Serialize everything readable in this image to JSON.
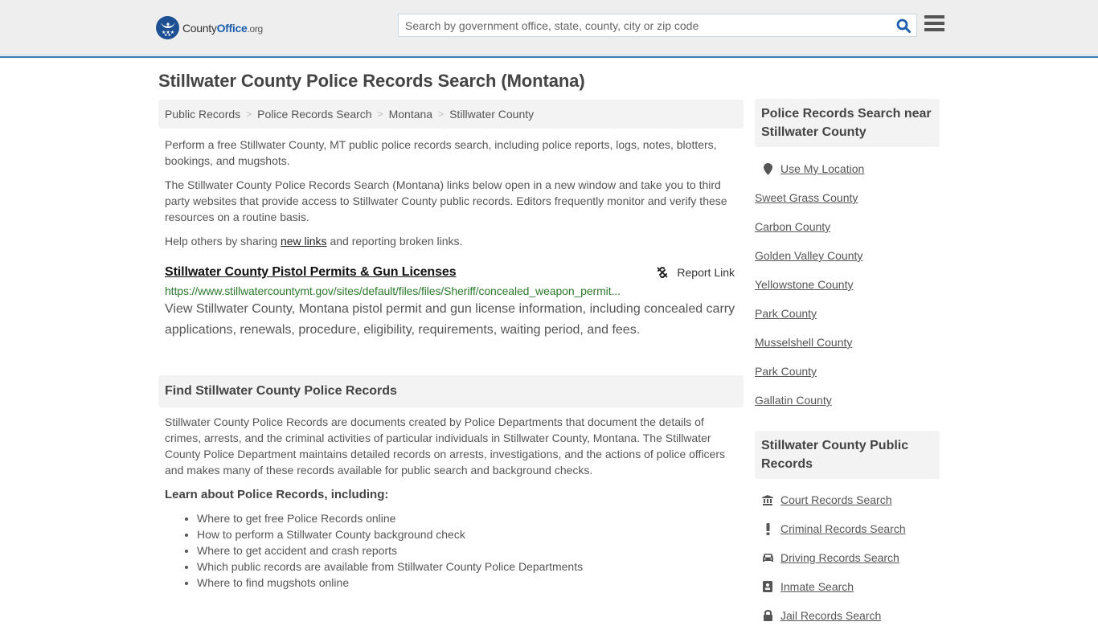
{
  "header": {
    "logo": {
      "part1": "County",
      "part2": "Office",
      "part3": ".org"
    },
    "search_placeholder": "Search by government office, state, county, city or zip code",
    "search_icon": "search-icon",
    "menu_icon": "hamburger-menu-icon"
  },
  "page_title": "Stillwater County Police Records Search (Montana)",
  "breadcrumb": [
    "Public Records",
    "Police Records Search",
    "Montana",
    "Stillwater County"
  ],
  "intro": {
    "p1": "Perform a free Stillwater County, MT public police records search, including police reports, logs, notes, blotters, bookings, and mugshots.",
    "p2": "The Stillwater County Police Records Search (Montana) links below open in a new window and take you to third party websites that provide access to Stillwater County public records. Editors frequently monitor and verify these resources on a routine basis.",
    "p3_before": "Help others by sharing ",
    "p3_link": "new links",
    "p3_after": " and reporting broken links."
  },
  "results": [
    {
      "title": "Stillwater County Pistol Permits & Gun Licenses",
      "url": "https://www.stillwatercountymt.gov/sites/default/files/files/Sheriff/concealed_weapon_permit...",
      "description": "View Stillwater County, Montana pistol permit and gun license information, including concealed carry applications, renewals, procedure, eligibility, requirements, waiting period, and fees.",
      "report_label": "Report Link"
    }
  ],
  "find_section": {
    "heading": "Find Stillwater County Police Records",
    "body": "Stillwater County Police Records are documents created by Police Departments that document the details of crimes, arrests, and the criminal activities of particular individuals in Stillwater County, Montana. The Stillwater County Police Department maintains detailed records on arrests, investigations, and the actions of police officers and makes many of these records available for public search and background checks.",
    "learn_heading": "Learn about Police Records, including:",
    "learn_items": [
      "Where to get free Police Records online",
      "How to perform a Stillwater County background check",
      "Where to get accident and crash reports",
      "Which public records are available from Stillwater County Police Departments",
      "Where to find mugshots online"
    ]
  },
  "sidebar": {
    "nearby": {
      "heading": "Police Records Search near Stillwater County",
      "use_location": "Use My Location",
      "items": [
        "Sweet Grass County",
        "Carbon County",
        "Golden Valley County",
        "Yellowstone County",
        "Park County",
        "Musselshell County",
        "Park County",
        "Gallatin County"
      ]
    },
    "public_records": {
      "heading": "Stillwater County Public Records",
      "items": [
        {
          "label": "Court Records Search",
          "icon": "courthouse-icon"
        },
        {
          "label": "Criminal Records Search",
          "icon": "exclamation-icon"
        },
        {
          "label": "Driving Records Search",
          "icon": "car-icon"
        },
        {
          "label": "Inmate Search",
          "icon": "id-badge-icon"
        },
        {
          "label": "Jail Records Search",
          "icon": "lock-icon"
        }
      ]
    }
  }
}
